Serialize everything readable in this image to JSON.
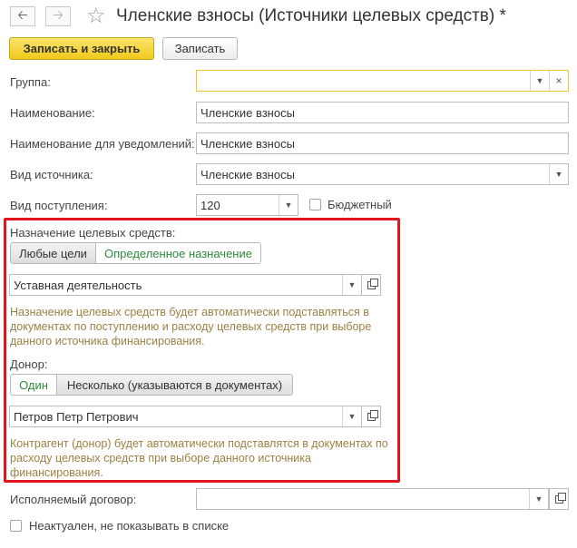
{
  "header": {
    "back_icon": "arrow-left-icon",
    "forward_icon": "arrow-right-icon",
    "favorite_icon": "star-icon",
    "title": "Членские взносы (Источники целевых средств) *"
  },
  "toolbar": {
    "save_close_label": "Записать и закрыть",
    "save_label": "Записать"
  },
  "form": {
    "group_label": "Группа:",
    "group_value": "",
    "name_label": "Наименование:",
    "name_value": "Членские взносы",
    "notify_name_label": "Наименование для уведомлений:",
    "notify_name_value": "Членские взносы",
    "source_type_label": "Вид источника:",
    "source_type_value": "Членские взносы",
    "income_type_label": "Вид поступления:",
    "income_type_value": "120",
    "budget_label": "Бюджетный",
    "budget_checked": false,
    "purpose_label": "Назначение целевых средств:",
    "purpose_options": [
      "Любые цели",
      "Определенное назначение"
    ],
    "purpose_selected": "Определенное назначение",
    "purpose_value": "Уставная деятельность",
    "purpose_note": "Назначение целевых средств будет автоматически подставляться в документах по поступлению и расходу целевых средств при выборе данного источника финансирования.",
    "donor_label": "Донор:",
    "donor_options": [
      "Один",
      "Несколько (указываются в документах)"
    ],
    "donor_selected": "Один",
    "donor_value": "Петров Петр Петрович",
    "donor_note": "Контрагент (донор) будет автоматически подставлятся в документах по расходу целевых средств при выборе данного источника финансирования.",
    "contract_label": "Исполняемый договор:",
    "contract_value": "",
    "inactive_label": "Неактуален, не показывать в списке",
    "inactive_checked": false
  },
  "colors": {
    "primary_button": "#f1c91b",
    "highlight_frame": "#e3141b",
    "selected_option_text": "#2e8b3b",
    "note_text": "#9b8244"
  }
}
